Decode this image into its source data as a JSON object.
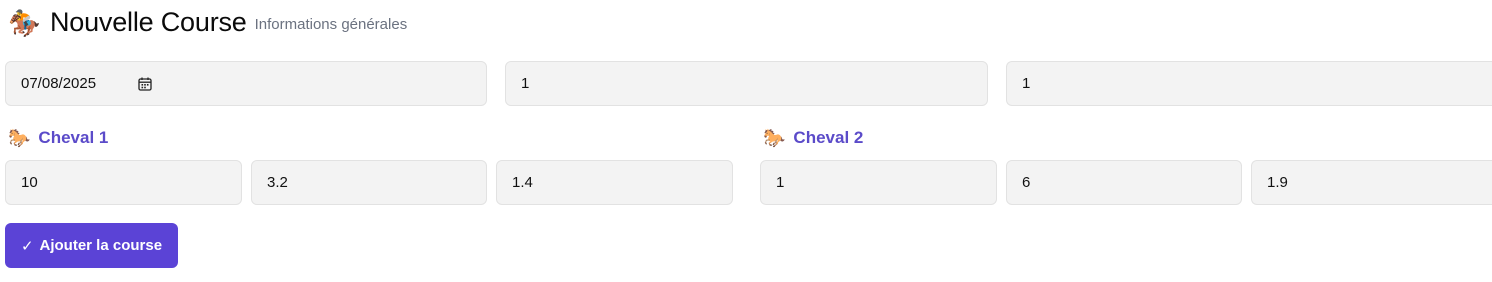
{
  "header": {
    "icon": "horse-racing-icon",
    "icon_glyph": "🏇",
    "title": "Nouvelle Course",
    "subtitle": "Informations générales"
  },
  "general": {
    "date_value": "07/08/2025",
    "field2_value": "1",
    "field3_value": "1"
  },
  "horse1": {
    "icon": "horse-icon",
    "icon_glyph": "🐎",
    "title": "Cheval 1",
    "field1_value": "10",
    "field2_value": "3.2",
    "field3_value": "1.4"
  },
  "horse2": {
    "icon": "horse-icon",
    "icon_glyph": "🐎",
    "title": "Cheval 2",
    "field1_value": "1",
    "field2_value": "6",
    "field3_value": "1.9"
  },
  "submit": {
    "check_glyph": "✓",
    "label": "Ajouter la course"
  },
  "colors": {
    "accent": "#5b43d6",
    "section_title": "#5b4bc9",
    "field_bg": "#f3f3f3",
    "subtitle": "#6b7280"
  }
}
